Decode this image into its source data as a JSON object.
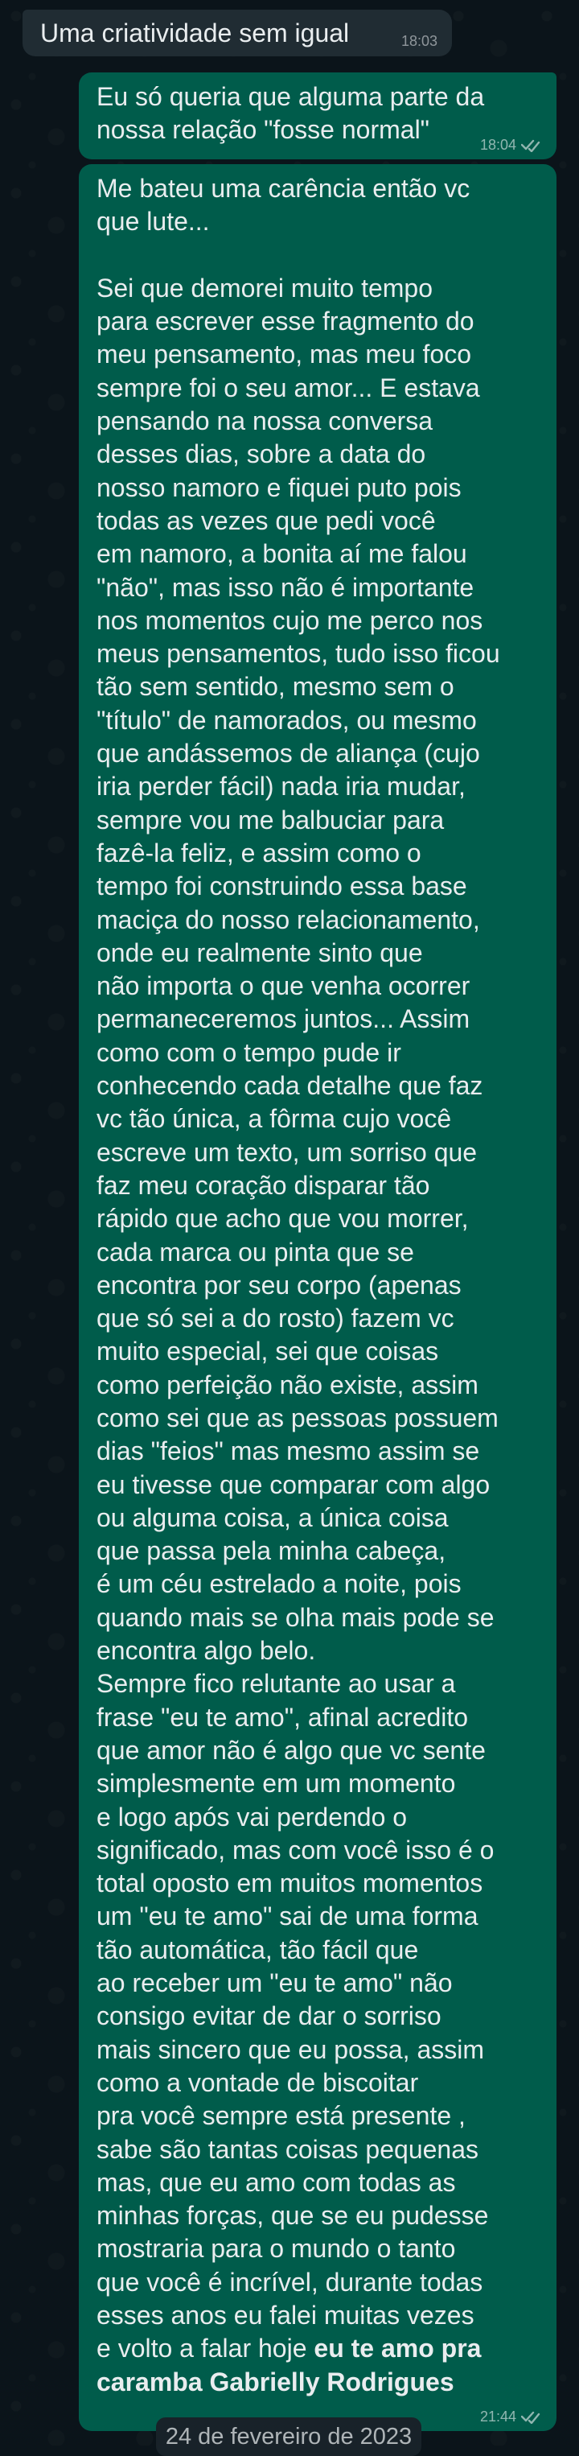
{
  "messages": [
    {
      "text": "Uma criatividade sem igual",
      "time": "18:03"
    },
    {
      "text": "Eu só queria que alguma parte da\nnossa relação \"fosse normal\"",
      "time": "18:04"
    },
    {
      "text": "Me bateu uma carência então vc\nque lute...\n\nSei que demorei muito tempo\npara escrever esse fragmento do\nmeu pensamento, mas meu foco\nsempre foi o seu amor... E estava\npensando na nossa conversa\ndesses dias, sobre a data do\nnosso namoro e fiquei puto pois\ntodas as vezes que pedi você\nem namoro, a bonita aí me falou\n\"não\", mas isso não é importante\nnos momentos cujo me perco nos\nmeus pensamentos, tudo isso ficou\ntão sem sentido, mesmo sem o\n\"título\" de namorados, ou mesmo\nque andássemos de aliança (cujo\niria perder fácil) nada iria mudar,\nsempre vou me balbuciar para\nfazê-la feliz, e assim como o\ntempo foi construindo essa base\nmaciça do nosso relacionamento,\nonde eu realmente sinto que\nnão importa o que venha ocorrer\npermaneceremos juntos... Assim\ncomo com o tempo pude ir\nconhecendo cada detalhe que faz\nvc tão única, a fôrma cujo você\nescreve um texto, um sorriso que\nfaz meu coração disparar tão\nrápido que acho que vou morrer,\ncada marca ou pinta que se\nencontra por seu corpo (apenas\nque só sei a do rosto) fazem vc\nmuito especial, sei que coisas\ncomo perfeição não existe, assim\ncomo sei que as pessoas possuem\ndias \"feios\" mas mesmo assim se\neu tivesse que comparar com algo\nou alguma coisa, a única coisa\nque passa pela minha cabeça,\né um céu estrelado a noite, pois\nquando mais se olha mais pode se\nencontra algo belo.\nSempre fico relutante ao usar a\nfrase \"eu te amo\", afinal acredito\nque amor não é algo que vc sente\nsimplesmente em um momento\ne logo após vai perdendo o\nsignificado, mas com você isso é o\ntotal oposto em muitos momentos\num \"eu te amo\" sai de uma forma\ntão automática, tão fácil que\nao receber um \"eu te amo\" não\nconsigo evitar de dar o sorriso\nmais sincero que eu possa, assim\ncomo a vontade de biscoitar\npra você sempre está presente ,\nsabe são tantas coisas pequenas\nmas, que eu amo com todas as\nminhas forças, que se eu pudesse\nmostraria para o mundo o tanto\nque você é incrível, durante todas\nesses anos eu falei muitas vezes\ne volto a falar hoje ",
      "text_bold": "eu te amo pra\ncaramba Gabrielly Rodrigues",
      "time": "21:44"
    }
  ],
  "date_separator": "24 de fevereiro de 2023",
  "colors": {
    "background": "#0b141a",
    "incoming_bubble": "#202c33",
    "outgoing_bubble": "#005c4b",
    "text": "#e9edef"
  },
  "icons": {
    "read_receipt": "double-check-icon"
  }
}
